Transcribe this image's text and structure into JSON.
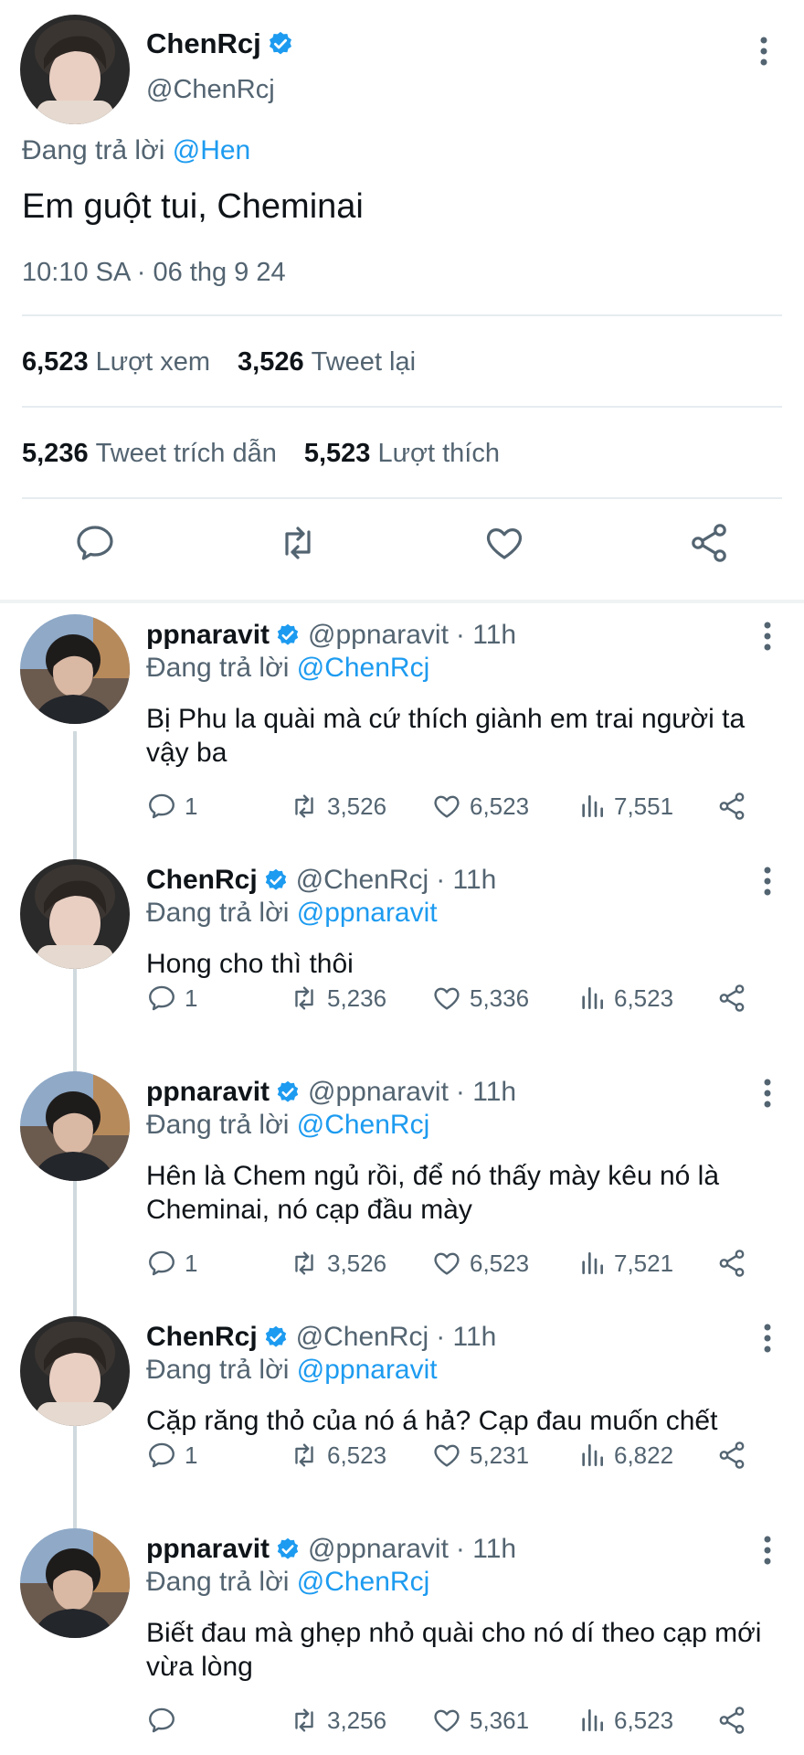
{
  "main_tweet": {
    "author_name": "ChenRcj",
    "author_handle": "@ChenRcj",
    "reply_prefix": "Đang trả lời",
    "reply_to": "@Hen",
    "text": "Em guột tui, Cheminai",
    "timestamp": "10:10 SA · 06 thg 9 24",
    "stats": {
      "views_count": "6,523",
      "views_label": "Lượt xem",
      "retweets_count": "3,526",
      "retweets_label": "Tweet lại",
      "quotes_count": "5,236",
      "quotes_label": "Tweet trích dẫn",
      "likes_count": "5,523",
      "likes_label": "Lượt thích"
    },
    "actions": [
      "reply-icon",
      "retweet-icon",
      "like-icon",
      "share-icon"
    ]
  },
  "replies": [
    {
      "name": "ppnaravit",
      "handle": "@ppnaravit",
      "time": "· 11h",
      "reply_prefix": "Đang trả lời",
      "reply_to": "@ChenRcj",
      "text": "Bị Phu la quài mà cứ thích giành em trai người ta vậy ba",
      "reply_count": "1",
      "retweet_count": "3,526",
      "like_count": "6,523",
      "view_count": "7,551"
    },
    {
      "name": "ChenRcj",
      "handle": "@ChenRcj",
      "time": "· 11h",
      "reply_prefix": "Đang trả lời",
      "reply_to": "@ppnaravit",
      "text": "Hong cho thì thôi",
      "reply_count": "1",
      "retweet_count": "5,236",
      "like_count": "5,336",
      "view_count": "6,523"
    },
    {
      "name": "ppnaravit",
      "handle": "@ppnaravit",
      "time": "· 11h",
      "reply_prefix": "Đang trả lời",
      "reply_to": "@ChenRcj",
      "text": "Hên là Chem ngủ rồi, để nó thấy mày kêu nó là Cheminai, nó cạp đầu mày",
      "reply_count": "1",
      "retweet_count": "3,526",
      "like_count": "6,523",
      "view_count": "7,521"
    },
    {
      "name": "ChenRcj",
      "handle": "@ChenRcj",
      "time": "· 11h",
      "reply_prefix": "Đang trả lời",
      "reply_to": "@ppnaravit",
      "text": "Cặp răng thỏ của nó á hả? Cạp đau muốn chết",
      "reply_count": "1",
      "retweet_count": "6,523",
      "like_count": "5,231",
      "view_count": "6,822"
    },
    {
      "name": "ppnaravit",
      "handle": "@ppnaravit",
      "time": "· 11h",
      "reply_prefix": "Đang trả lời",
      "reply_to": "@ChenRcj",
      "text": "Biết đau mà ghẹp nhỏ quài cho nó dí theo cạp mới vừa lòng",
      "reply_count": "",
      "retweet_count": "3,256",
      "like_count": "5,361",
      "view_count": "6,523"
    }
  ],
  "colors": {
    "accent": "#1d9bf0",
    "text_primary": "#0f1419",
    "text_secondary": "#536471",
    "divider": "#e6ecf0"
  }
}
